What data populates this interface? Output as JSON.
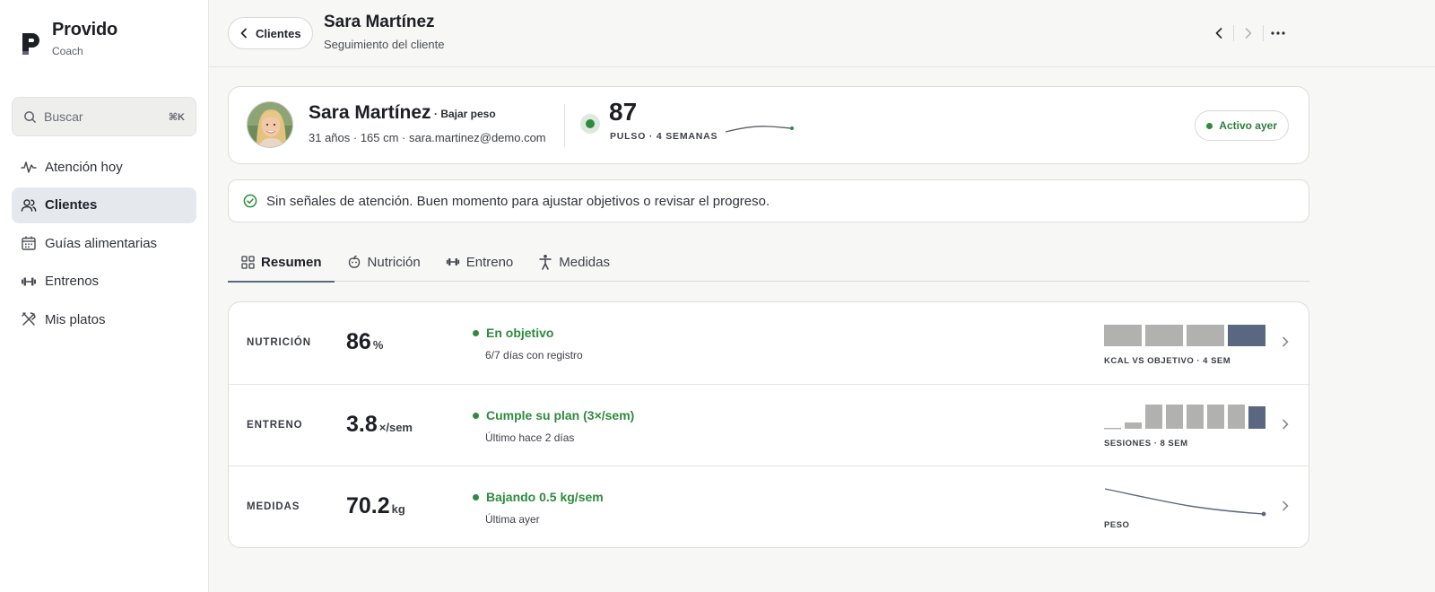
{
  "brand": {
    "name": "Provido",
    "sub": "Coach"
  },
  "search": {
    "placeholder": "Buscar",
    "shortcut": "⌘K"
  },
  "sidebar": {
    "items": [
      {
        "label": "Atención hoy",
        "icon": "activity-icon",
        "active": false
      },
      {
        "label": "Clientes",
        "icon": "users-icon",
        "active": true
      },
      {
        "label": "Guías alimentarias",
        "icon": "calendar-icon",
        "active": false
      },
      {
        "label": "Entrenos",
        "icon": "dumbbell-icon",
        "active": false
      },
      {
        "label": "Mis platos",
        "icon": "utensils-icon",
        "active": false
      }
    ]
  },
  "header": {
    "back_label": "Clientes",
    "title": "Sara Martínez",
    "subtitle": "Seguimiento del cliente"
  },
  "profile": {
    "name": "Sara Martínez",
    "goal": "· Bajar peso",
    "meta": "31 años · 165 cm · sara.martinez@demo.com",
    "pulse_value": "87",
    "pulse_label": "PULSO · 4 SEMANAS",
    "status": "Activo ayer"
  },
  "alert": {
    "text": "Sin señales de atención. Buen momento para ajustar objetivos o revisar el progreso."
  },
  "tabs": [
    {
      "label": "Resumen",
      "icon": "grid-icon",
      "active": true
    },
    {
      "label": "Nutrición",
      "icon": "apple-icon",
      "active": false
    },
    {
      "label": "Entreno",
      "icon": "dumbbell-icon",
      "active": false
    },
    {
      "label": "Medidas",
      "icon": "person-icon",
      "active": false
    }
  ],
  "metrics": {
    "rows": [
      {
        "label": "NUTRICIÓN",
        "value": "86",
        "unit": "%",
        "status": "En objetivo",
        "detail": "6/7 días con registro",
        "chart_label": "KCAL VS OBJETIVO · 4 SEM"
      },
      {
        "label": "ENTRENO",
        "value": "3.8",
        "unit": "×/sem",
        "status": "Cumple su plan (3×/sem)",
        "detail": "Último hace 2 días",
        "chart_label": "SESIONES · 8 SEM"
      },
      {
        "label": "MEDIDAS",
        "value": "70.2",
        "unit": "kg",
        "status": "Bajando 0.5 kg/sem",
        "detail": "Última ayer",
        "chart_label": "PESO"
      }
    ]
  },
  "colors": {
    "accent": "#5a6780",
    "success": "#2e8b3d",
    "bar_muted": "#b1b1b0",
    "bar_highlight": "#5a6780"
  }
}
